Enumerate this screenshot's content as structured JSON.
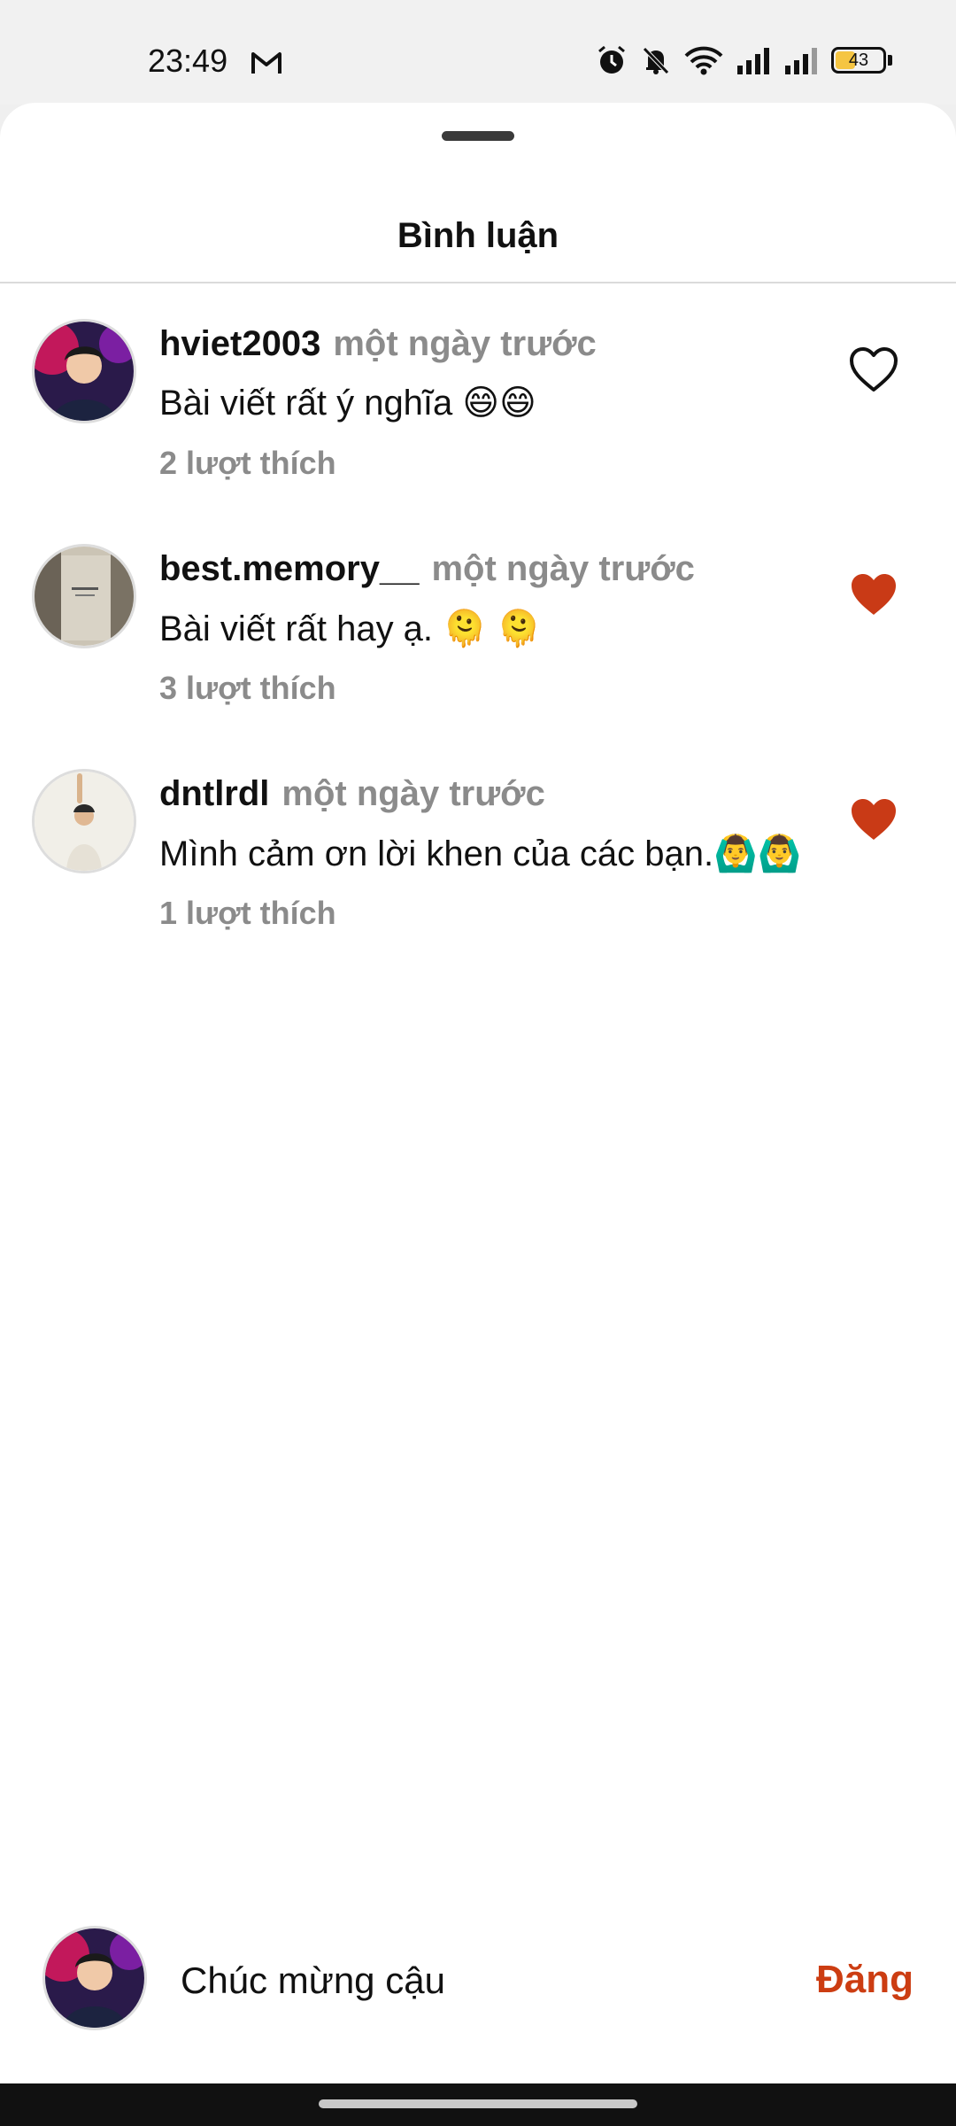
{
  "status_bar": {
    "time": "23:49",
    "battery": "43",
    "battery_level": 0.43,
    "icons": [
      "gmail-icon",
      "alarm-icon",
      "bell-muted-icon",
      "wifi-icon",
      "signal-icon",
      "signal-icon",
      "battery-icon"
    ]
  },
  "sheet": {
    "title": "Bình luận"
  },
  "comments": [
    {
      "username": "hviet2003",
      "time": "một ngày trước",
      "text": "Bài viết rất ý nghĩa 😄😄",
      "likes": "2 lượt thích",
      "liked": false
    },
    {
      "username": "best.memory__",
      "time": "một ngày trước",
      "text": "Bài viết rất hay ạ. 🫠 🫠",
      "likes": "3 lượt thích",
      "liked": true
    },
    {
      "username": "dntlrdl",
      "time": "một ngày trước",
      "text": "Mình cảm ơn lời khen của các bạn.🙆‍♂️🙆‍♂️",
      "likes": "1 lượt thích",
      "liked": true
    }
  ],
  "composer": {
    "value": "Chúc mừng cậu",
    "post_label": "Đăng"
  },
  "colors": {
    "accent": "#cc3d12",
    "heart_filled": "#c93a16",
    "muted_text": "#8b8b8b"
  }
}
